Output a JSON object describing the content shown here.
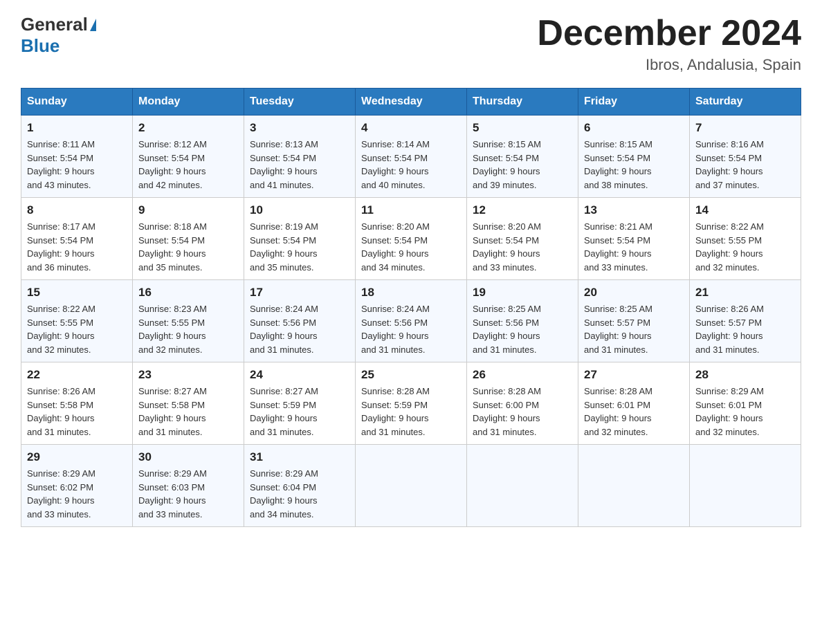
{
  "header": {
    "logo_general": "General",
    "logo_blue": "Blue",
    "month": "December 2024",
    "location": "Ibros, Andalusia, Spain"
  },
  "days_of_week": [
    "Sunday",
    "Monday",
    "Tuesday",
    "Wednesday",
    "Thursday",
    "Friday",
    "Saturday"
  ],
  "weeks": [
    [
      {
        "day": "1",
        "sunrise": "8:11 AM",
        "sunset": "5:54 PM",
        "daylight": "9 hours and 43 minutes."
      },
      {
        "day": "2",
        "sunrise": "8:12 AM",
        "sunset": "5:54 PM",
        "daylight": "9 hours and 42 minutes."
      },
      {
        "day": "3",
        "sunrise": "8:13 AM",
        "sunset": "5:54 PM",
        "daylight": "9 hours and 41 minutes."
      },
      {
        "day": "4",
        "sunrise": "8:14 AM",
        "sunset": "5:54 PM",
        "daylight": "9 hours and 40 minutes."
      },
      {
        "day": "5",
        "sunrise": "8:15 AM",
        "sunset": "5:54 PM",
        "daylight": "9 hours and 39 minutes."
      },
      {
        "day": "6",
        "sunrise": "8:15 AM",
        "sunset": "5:54 PM",
        "daylight": "9 hours and 38 minutes."
      },
      {
        "day": "7",
        "sunrise": "8:16 AM",
        "sunset": "5:54 PM",
        "daylight": "9 hours and 37 minutes."
      }
    ],
    [
      {
        "day": "8",
        "sunrise": "8:17 AM",
        "sunset": "5:54 PM",
        "daylight": "9 hours and 36 minutes."
      },
      {
        "day": "9",
        "sunrise": "8:18 AM",
        "sunset": "5:54 PM",
        "daylight": "9 hours and 35 minutes."
      },
      {
        "day": "10",
        "sunrise": "8:19 AM",
        "sunset": "5:54 PM",
        "daylight": "9 hours and 35 minutes."
      },
      {
        "day": "11",
        "sunrise": "8:20 AM",
        "sunset": "5:54 PM",
        "daylight": "9 hours and 34 minutes."
      },
      {
        "day": "12",
        "sunrise": "8:20 AM",
        "sunset": "5:54 PM",
        "daylight": "9 hours and 33 minutes."
      },
      {
        "day": "13",
        "sunrise": "8:21 AM",
        "sunset": "5:54 PM",
        "daylight": "9 hours and 33 minutes."
      },
      {
        "day": "14",
        "sunrise": "8:22 AM",
        "sunset": "5:55 PM",
        "daylight": "9 hours and 32 minutes."
      }
    ],
    [
      {
        "day": "15",
        "sunrise": "8:22 AM",
        "sunset": "5:55 PM",
        "daylight": "9 hours and 32 minutes."
      },
      {
        "day": "16",
        "sunrise": "8:23 AM",
        "sunset": "5:55 PM",
        "daylight": "9 hours and 32 minutes."
      },
      {
        "day": "17",
        "sunrise": "8:24 AM",
        "sunset": "5:56 PM",
        "daylight": "9 hours and 31 minutes."
      },
      {
        "day": "18",
        "sunrise": "8:24 AM",
        "sunset": "5:56 PM",
        "daylight": "9 hours and 31 minutes."
      },
      {
        "day": "19",
        "sunrise": "8:25 AM",
        "sunset": "5:56 PM",
        "daylight": "9 hours and 31 minutes."
      },
      {
        "day": "20",
        "sunrise": "8:25 AM",
        "sunset": "5:57 PM",
        "daylight": "9 hours and 31 minutes."
      },
      {
        "day": "21",
        "sunrise": "8:26 AM",
        "sunset": "5:57 PM",
        "daylight": "9 hours and 31 minutes."
      }
    ],
    [
      {
        "day": "22",
        "sunrise": "8:26 AM",
        "sunset": "5:58 PM",
        "daylight": "9 hours and 31 minutes."
      },
      {
        "day": "23",
        "sunrise": "8:27 AM",
        "sunset": "5:58 PM",
        "daylight": "9 hours and 31 minutes."
      },
      {
        "day": "24",
        "sunrise": "8:27 AM",
        "sunset": "5:59 PM",
        "daylight": "9 hours and 31 minutes."
      },
      {
        "day": "25",
        "sunrise": "8:28 AM",
        "sunset": "5:59 PM",
        "daylight": "9 hours and 31 minutes."
      },
      {
        "day": "26",
        "sunrise": "8:28 AM",
        "sunset": "6:00 PM",
        "daylight": "9 hours and 31 minutes."
      },
      {
        "day": "27",
        "sunrise": "8:28 AM",
        "sunset": "6:01 PM",
        "daylight": "9 hours and 32 minutes."
      },
      {
        "day": "28",
        "sunrise": "8:29 AM",
        "sunset": "6:01 PM",
        "daylight": "9 hours and 32 minutes."
      }
    ],
    [
      {
        "day": "29",
        "sunrise": "8:29 AM",
        "sunset": "6:02 PM",
        "daylight": "9 hours and 33 minutes."
      },
      {
        "day": "30",
        "sunrise": "8:29 AM",
        "sunset": "6:03 PM",
        "daylight": "9 hours and 33 minutes."
      },
      {
        "day": "31",
        "sunrise": "8:29 AM",
        "sunset": "6:04 PM",
        "daylight": "9 hours and 34 minutes."
      },
      null,
      null,
      null,
      null
    ]
  ],
  "labels": {
    "sunrise": "Sunrise:",
    "sunset": "Sunset:",
    "daylight": "Daylight:"
  }
}
